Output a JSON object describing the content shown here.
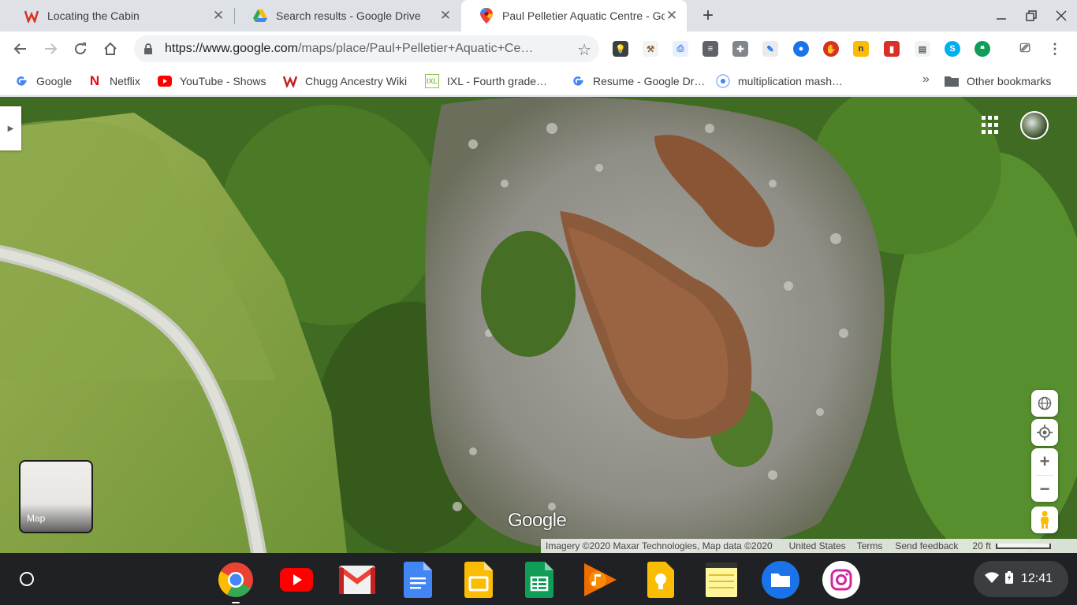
{
  "browser": {
    "tabs": [
      {
        "title": "Locating the Cabin",
        "favicon": "w-icon",
        "active": false
      },
      {
        "title": "Search results - Google Drive",
        "favicon": "drive-icon",
        "active": false
      },
      {
        "title": "Paul Pelletier Aquatic Centre - Go",
        "favicon": "maps-pin-icon",
        "active": true
      }
    ],
    "url_host": "https://www.google.com",
    "url_path": "/maps/place/Paul+Pelletier+Aquatic+Ce…",
    "bookmarks": [
      {
        "label": "Google",
        "icon": "google-icon"
      },
      {
        "label": "Netflix",
        "icon": "netflix-icon"
      },
      {
        "label": "YouTube - Shows",
        "icon": "youtube-icon"
      },
      {
        "label": "Chugg Ancestry Wiki",
        "icon": "w-icon"
      },
      {
        "label": "IXL - Fourth grade…",
        "icon": "ixl-icon"
      },
      {
        "label": "Resume - Google Dr…",
        "icon": "google-icon"
      },
      {
        "label": "multiplication mash…",
        "icon": "target-icon"
      }
    ],
    "other_bookmarks": "Other bookmarks",
    "overflow_chevron": "»"
  },
  "map": {
    "layer_toggle_label": "Map",
    "logo": "Google",
    "attribution": "Imagery ©2020 Maxar Technologies, Map data ©2020",
    "country": "United States",
    "terms": "Terms",
    "feedback": "Send feedback",
    "scale": "20 ft"
  },
  "shelf": {
    "apps": [
      "chrome-icon",
      "youtube-icon",
      "gmail-icon",
      "docs-icon",
      "slides-icon",
      "sheets-icon",
      "play-music-icon",
      "keep-icon",
      "notes-icon",
      "files-icon",
      "instagram-icon"
    ],
    "time": "12:41"
  },
  "colors": {
    "brand_red": "#ea4335",
    "brand_blue": "#4285f4",
    "brand_yellow": "#fbbc04",
    "brand_green": "#34a853"
  }
}
